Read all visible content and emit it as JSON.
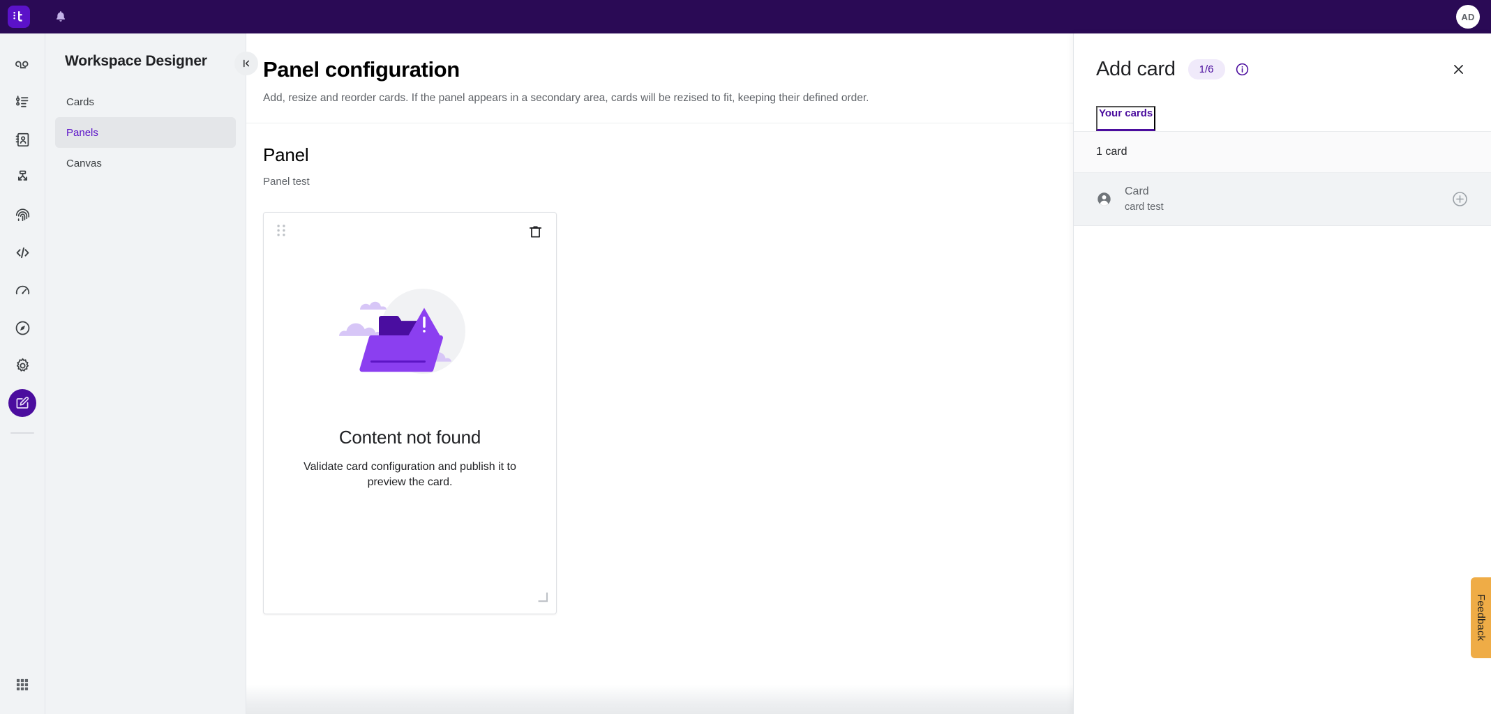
{
  "topbar": {
    "logo_icon": "app-logo-icon",
    "logo_letter": "t",
    "notifications_icon": "bell-icon",
    "avatar_initials": "AD"
  },
  "rail": {
    "items": [
      {
        "icon": "loop-icon",
        "name": "journeys"
      },
      {
        "icon": "list-icon",
        "name": "tasks"
      },
      {
        "icon": "contact-book-icon",
        "name": "contacts"
      },
      {
        "icon": "flow-branch-icon",
        "name": "flows"
      },
      {
        "icon": "fingerprint-icon",
        "name": "identity"
      },
      {
        "icon": "code-icon",
        "name": "developer"
      },
      {
        "icon": "gauge-icon",
        "name": "performance"
      },
      {
        "icon": "compass-icon",
        "name": "explore"
      },
      {
        "icon": "gear-icon",
        "name": "settings"
      },
      {
        "icon": "edit-card-icon",
        "name": "workspace-designer",
        "active": true
      }
    ],
    "bottom_icon": "apps-grid-icon"
  },
  "subnav": {
    "title": "Workspace Designer",
    "items": [
      {
        "label": "Cards",
        "active": false
      },
      {
        "label": "Panels",
        "active": true
      },
      {
        "label": "Canvas",
        "active": false
      }
    ],
    "collapse_icon": "collapse-left-icon"
  },
  "main": {
    "title": "Panel configuration",
    "subtitle": "Add, resize and reorder cards. If the panel appears in a secondary area, cards will be rezised to fit, keeping their defined order.",
    "panel": {
      "name": "Panel",
      "description": "Panel test"
    },
    "preview_card": {
      "drag_icon": "drag-handle-icon",
      "delete_icon": "trash-icon",
      "illustration": "folder-warning-illustration",
      "empty_title": "Content not found",
      "empty_description": "Validate card configuration and publish it to preview the card.",
      "resize_icon": "resize-corner-icon"
    }
  },
  "drawer": {
    "title": "Add card",
    "count_badge": "1/6",
    "info_icon": "info-icon",
    "close_icon": "close-icon",
    "tabs": [
      {
        "label": "Your cards",
        "active": true
      }
    ],
    "list_header": "1 card",
    "cards": [
      {
        "avatar_icon": "person-icon",
        "title": "Card",
        "subtitle": "card test",
        "add_icon": "plus-circle-icon"
      }
    ]
  },
  "feedback": {
    "label": "Feedback"
  },
  "colors": {
    "topbar_bg": "#2A0A55",
    "brand_purple": "#5B12C8",
    "accent_purple": "#4B0D9E",
    "rail_bg": "#F1F3F5",
    "feedback_orange": "#EFAC46"
  }
}
